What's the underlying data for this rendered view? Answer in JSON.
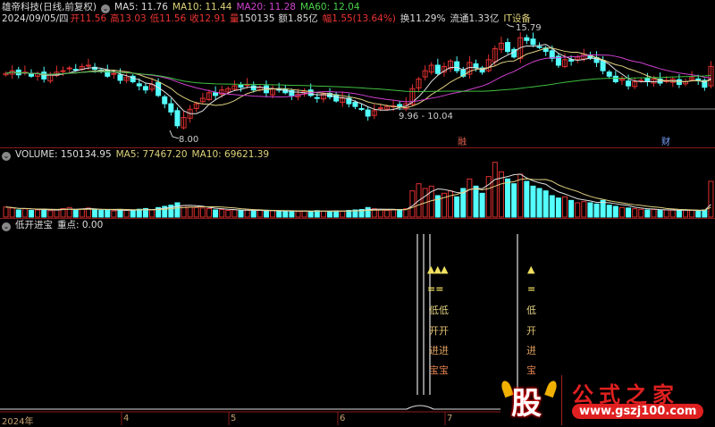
{
  "header": {
    "stock_name": "雄帝科技(日线,前复权)",
    "ma5": "MA5: 11.76",
    "ma10": "MA10: 11.44",
    "ma20": "MA20: 11.28",
    "ma60": "MA60: 12.04"
  },
  "quote": {
    "date": "2024/09/05/四",
    "open_label": "开",
    "open": "11.56",
    "high_label": "高",
    "high": "13.03",
    "low_label": "低",
    "low": "11.56",
    "close_label": "收",
    "close": "12.91",
    "vol_label": "量",
    "vol": "150135",
    "amount": "额1.85亿",
    "chg_label": "幅",
    "chg": "1.55(13.64%)",
    "turnover": "换11.29%",
    "float": "流通1.33亿",
    "sector": "IT设备"
  },
  "volume_header": {
    "volume": "VOLUME: 150134.95",
    "ma5": "MA5: 77467.20",
    "ma10": "MA10: 69621.39"
  },
  "indicator_header": {
    "name": "低开进宝",
    "value": "重点: 0.00"
  },
  "annotations": {
    "low": "8.00",
    "range": "9.96 - 10.04",
    "high": "15.79",
    "tag1": "融",
    "tag2": "财"
  },
  "signal_chars": {
    "arrow": "▲",
    "eq": "=",
    "c1": "低",
    "c2": "开",
    "c3": "进",
    "c4": "宝"
  },
  "axis": {
    "year": "2024年",
    "m4": "4",
    "m5": "5",
    "m6": "6",
    "m7": "7"
  },
  "watermark": {
    "gu": "股",
    "name": "公式之家",
    "url": "www.gszj100.com"
  },
  "colors": {
    "up": "#e03030",
    "down": "#54ffff",
    "ma5": "#e0e0e0",
    "ma10": "#e0d080",
    "ma20": "#d040d0",
    "ma60": "#40c040"
  },
  "chart_data": {
    "type": "candlestick",
    "price_range": [
      8.0,
      15.79
    ],
    "closes": [
      12.4,
      12.6,
      12.3,
      12.5,
      12.2,
      12.4,
      12.0,
      12.3,
      12.5,
      12.6,
      12.8,
      12.7,
      12.9,
      13.0,
      12.7,
      12.6,
      12.2,
      12.4,
      11.9,
      12.1,
      11.8,
      11.5,
      11.2,
      11.6,
      10.8,
      10.2,
      9.6,
      8.6,
      9.2,
      9.8,
      10.2,
      10.6,
      11.0,
      10.8,
      11.2,
      11.3,
      11.5,
      11.4,
      11.6,
      11.2,
      11.4,
      11.0,
      11.3,
      11.2,
      11.0,
      10.8,
      10.9,
      11.1,
      10.8,
      10.6,
      10.9,
      10.7,
      10.4,
      10.6,
      10.2,
      10.0,
      9.8,
      9.3,
      9.7,
      9.9,
      10.0,
      10.04,
      10.0,
      10.2,
      11.3,
      12.0,
      12.6,
      13.0,
      12.4,
      12.9,
      13.3,
      12.6,
      12.2,
      13.2,
      12.8,
      12.5,
      13.4,
      14.2,
      14.6,
      14.0,
      13.6,
      15.0,
      14.8,
      14.5,
      14.3,
      14.0,
      13.5,
      13.0,
      13.4,
      13.3,
      13.6,
      13.8,
      13.5,
      13.2,
      12.6,
      12.2,
      11.8,
      12.0,
      11.5,
      11.8,
      11.9,
      11.8,
      12.0,
      11.7,
      11.9,
      12.0,
      11.6,
      11.8,
      12.1,
      11.9,
      11.4,
      12.91
    ],
    "volumes": [
      42000,
      38000,
      30000,
      35000,
      28000,
      30000,
      33000,
      27000,
      30000,
      36000,
      40000,
      32000,
      34000,
      38000,
      30000,
      28000,
      30000,
      26000,
      32000,
      28000,
      30000,
      33000,
      36000,
      30000,
      40000,
      45000,
      50000,
      60000,
      48000,
      42000,
      40000,
      38000,
      36000,
      30000,
      32000,
      28000,
      30000,
      27000,
      29000,
      26000,
      28000,
      25000,
      27000,
      24000,
      26000,
      25000,
      23000,
      26000,
      24000,
      27000,
      25000,
      24000,
      26000,
      25000,
      28000,
      30000,
      32000,
      40000,
      35000,
      30000,
      28000,
      30000,
      32000,
      35000,
      110000,
      140000,
      120000,
      130000,
      90000,
      100000,
      110000,
      85000,
      120000,
      160000,
      130000,
      100000,
      170000,
      230000,
      190000,
      160000,
      140000,
      180000,
      150000,
      130000,
      120000,
      110000,
      90000,
      80000,
      85000,
      70000,
      60000,
      65000,
      60000,
      55000,
      70000,
      50000,
      45000,
      40000,
      38000,
      35000,
      33000,
      30000,
      32000,
      28000,
      30000,
      29000,
      27000,
      30000,
      28000,
      26000,
      30000,
      150135
    ],
    "volume_ma": {
      "ma5": 77467.2,
      "ma10": 69621.39
    },
    "x_ticks": [
      "2024年",
      "4",
      "5",
      "6",
      "7"
    ]
  }
}
